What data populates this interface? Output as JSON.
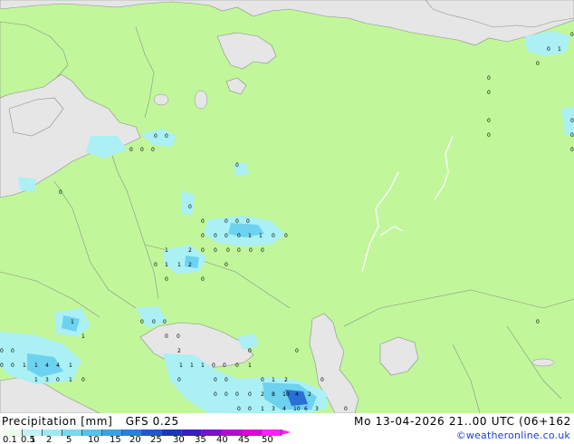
{
  "title": {
    "product": "Precipitation [mm]",
    "model": "GFS 0.25",
    "valid_time": "Mo 13-04-2026 21..00 UTC (06+162"
  },
  "credit": "©weatheronline.co.uk",
  "legend": {
    "levels": [
      {
        "label": "0.1",
        "color": "#eaffea"
      },
      {
        "label": "0.5",
        "color": "#bdf3f6"
      },
      {
        "label": "1",
        "color": "#9ee8f4"
      },
      {
        "label": "2",
        "color": "#7ad7f0"
      },
      {
        "label": "5",
        "color": "#56c1eb"
      },
      {
        "label": "10",
        "color": "#3aa1e2"
      },
      {
        "label": "15",
        "color": "#2a7fd8"
      },
      {
        "label": "20",
        "color": "#2158c9"
      },
      {
        "label": "25",
        "color": "#1a35b8"
      },
      {
        "label": "30",
        "color": "#3a1ec0"
      },
      {
        "label": "35",
        "color": "#7a12c8"
      },
      {
        "label": "40",
        "color": "#b40ad0"
      },
      {
        "label": "45",
        "color": "#e000d8"
      },
      {
        "label": "50",
        "color": "#ff20ff"
      }
    ]
  },
  "colors": {
    "land": "#c1f79a",
    "sea": "#e6e6e6",
    "border": "#8c8c8c",
    "precip_light": "#aaf0f4",
    "precip_mid": "#6cd2f0",
    "precip_heavy": "#2a6fd6"
  },
  "precip_values": [
    "0",
    "1",
    "2",
    "3",
    "4",
    "6",
    "10",
    "5"
  ]
}
